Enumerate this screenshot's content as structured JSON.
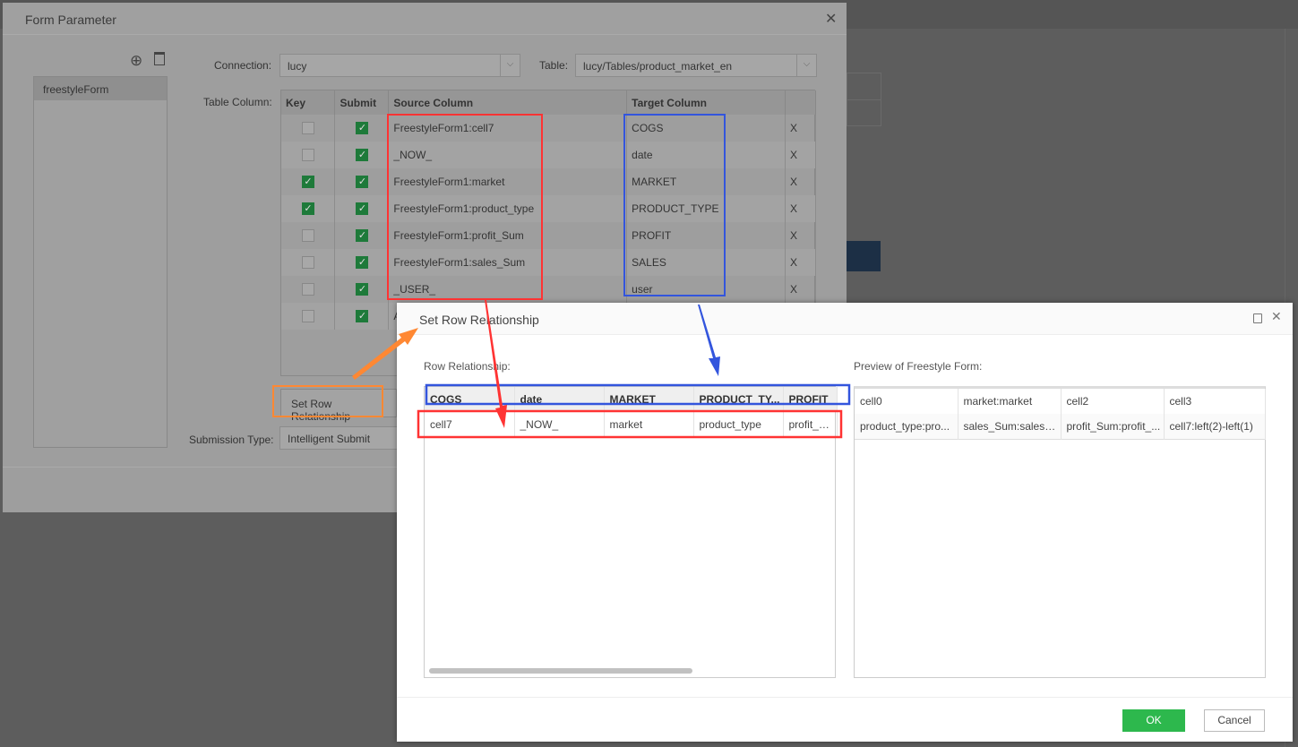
{
  "form_parameter": {
    "title": "Form Parameter",
    "close_icon": "close-icon",
    "forms": [
      "freestyleForm"
    ],
    "connection_label": "Connection:",
    "connection_value": "lucy",
    "table_label": "Table:",
    "table_value": "lucy/Tables/product_market_en",
    "table_column_label": "Table Column:",
    "headers": [
      "Key",
      "Submit",
      "Source Column",
      "Target Column",
      ""
    ],
    "rows": [
      {
        "key": false,
        "submit": true,
        "source": "FreestyleForm1:cell7",
        "target": "COGS",
        "del": "X"
      },
      {
        "key": false,
        "submit": true,
        "source": "_NOW_",
        "target": "date",
        "del": "X"
      },
      {
        "key": true,
        "submit": true,
        "source": "FreestyleForm1:market",
        "target": "MARKET",
        "del": "X"
      },
      {
        "key": true,
        "submit": true,
        "source": "FreestyleForm1:product_type",
        "target": "PRODUCT_TYPE",
        "del": "X"
      },
      {
        "key": false,
        "submit": true,
        "source": "FreestyleForm1:profit_Sum",
        "target": "PROFIT",
        "del": "X"
      },
      {
        "key": false,
        "submit": true,
        "source": "FreestyleForm1:sales_Sum",
        "target": "SALES",
        "del": "X"
      },
      {
        "key": false,
        "submit": true,
        "source": "_USER_",
        "target": "user",
        "del": "X"
      },
      {
        "key": false,
        "submit": true,
        "source": "A",
        "target": "",
        "del": ""
      }
    ],
    "set_row_button": "Set Row Relationship",
    "submission_type_label": "Submission Type:",
    "submission_type_value": "Intelligent Submit"
  },
  "set_row_relationship": {
    "title": "Set Row Relationship",
    "row_relationship_label": "Row Relationship:",
    "headers": [
      "COGS",
      "date",
      "MARKET",
      "PRODUCT_TY...",
      "PROFIT"
    ],
    "row": [
      "cell7",
      "_NOW_",
      "market",
      "product_type",
      "profit_Sum"
    ],
    "preview_label": "Preview of Freestyle Form:",
    "preview_rows": [
      [
        "cell0",
        "market:market",
        "cell2",
        "cell3"
      ],
      [
        "product_type:pro...",
        "sales_Sum:sales_S...",
        "profit_Sum:profit_...",
        "cell7:left(2)-left(1)"
      ]
    ],
    "ok": "OK",
    "cancel": "Cancel",
    "ok_color": "#2db84d"
  },
  "annotation_colors": {
    "source": "#ff3333",
    "target": "#3355dd",
    "button": "#ff8833"
  }
}
